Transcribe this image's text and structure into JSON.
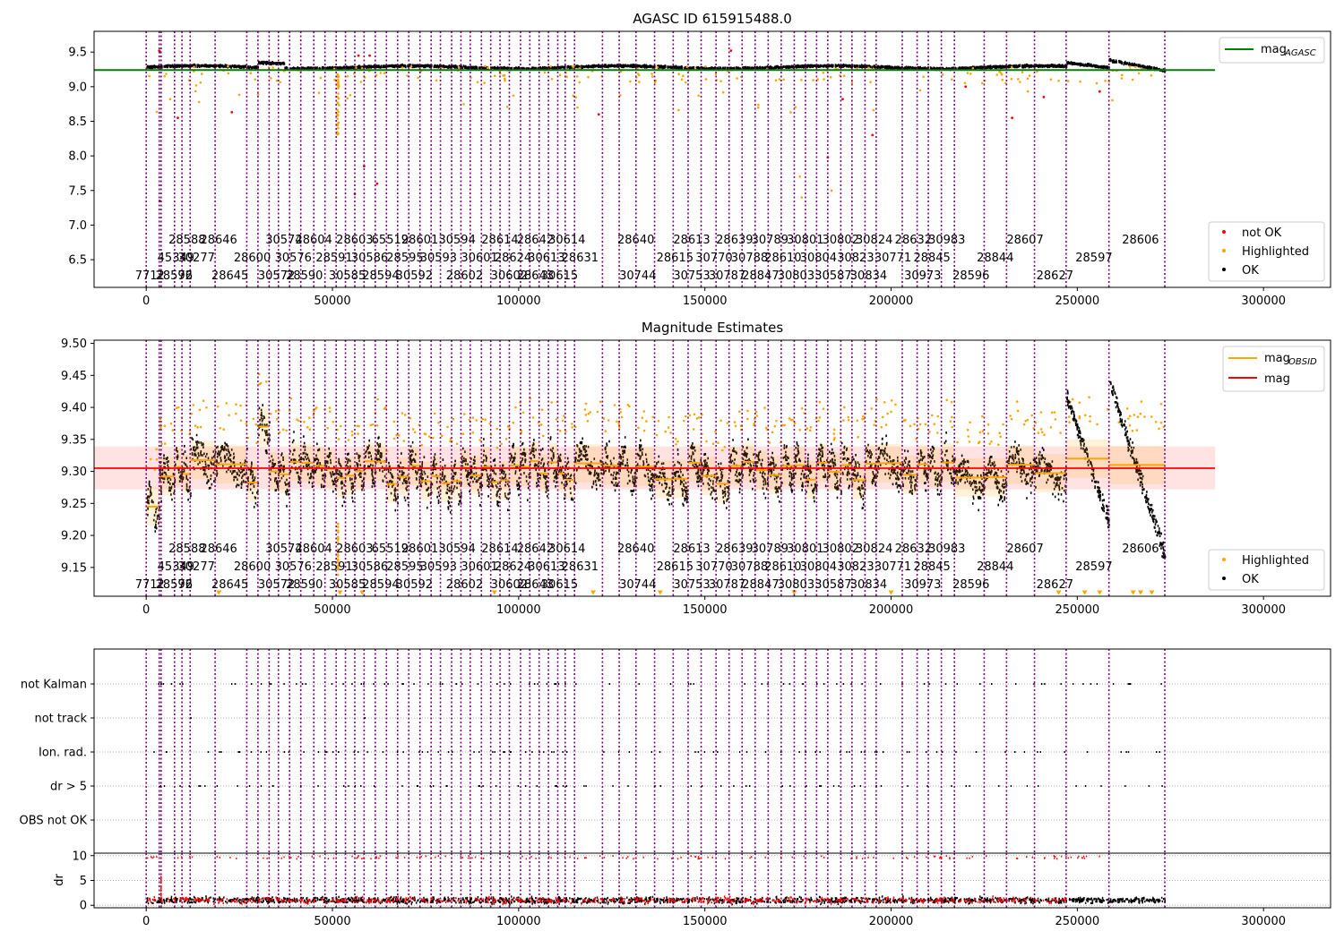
{
  "figure": {
    "background": "#ffffff"
  },
  "colors": {
    "ok": "#000000",
    "highlighted": "#ffa500",
    "not_ok": "#ff0000",
    "agasc_line": "#008000",
    "mag_line": "#ff0000",
    "mag_obsid_line": "#ffa500",
    "obs_boundary": "#800080",
    "mag_band": "#ffcccc"
  },
  "chart_data": [
    {
      "id": "panel-1",
      "type": "scatter",
      "title": "AGASC ID 615915488.0",
      "xlabel": "",
      "ylabel": "",
      "xlim": [
        -14000,
        318000
      ],
      "ylim": [
        6.1,
        9.8
      ],
      "x_ticks": [
        0,
        50000,
        100000,
        150000,
        200000,
        250000,
        300000
      ],
      "x_tick_labels": [
        "0",
        "50000",
        "100000",
        "150000",
        "200000",
        "250000",
        "300000"
      ],
      "y_ticks": [
        6.5,
        7.0,
        7.5,
        8.0,
        8.5,
        9.0,
        9.5
      ],
      "y_tick_labels": [
        "6.5",
        "7.0",
        "7.5",
        "8.0",
        "8.5",
        "9.0",
        "9.5"
      ],
      "grid": false,
      "agasc_mag": 9.24,
      "agasc_line_x": [
        -14000,
        287000
      ],
      "series": [
        {
          "name": "not OK",
          "color": "#ff0000"
        },
        {
          "name": "Highlighted",
          "color": "#ffa500"
        },
        {
          "name": "OK",
          "color": "#000000"
        }
      ],
      "legend_upper": {
        "position": "top-right",
        "entries": [
          {
            "label": "mag",
            "sub": "AGASC",
            "color": "#008000"
          }
        ]
      },
      "legend_lower": {
        "position": "bottom-right",
        "entries": [
          {
            "label": "not OK",
            "color": "#ff0000"
          },
          {
            "label": "Highlighted",
            "color": "#ffa500"
          },
          {
            "label": "OK",
            "color": "#000000"
          }
        ]
      }
    },
    {
      "id": "panel-2",
      "type": "scatter",
      "title": "Magnitude Estimates",
      "xlabel": "",
      "ylabel": "",
      "xlim": [
        -14000,
        318000
      ],
      "ylim": [
        9.105,
        9.505
      ],
      "x_ticks": [
        0,
        50000,
        100000,
        150000,
        200000,
        250000,
        300000
      ],
      "x_tick_labels": [
        "0",
        "50000",
        "100000",
        "150000",
        "200000",
        "250000",
        "300000"
      ],
      "y_ticks": [
        9.15,
        9.2,
        9.25,
        9.3,
        9.35,
        9.4,
        9.45,
        9.5
      ],
      "y_tick_labels": [
        "9.15",
        "9.20",
        "9.25",
        "9.30",
        "9.35",
        "9.40",
        "9.45",
        "9.50"
      ],
      "grid": false,
      "mag": 9.305,
      "mag_band": [
        9.272,
        9.339
      ],
      "mag_line_x": [
        -14000,
        287000
      ],
      "legend_upper": {
        "position": "top-right",
        "entries": [
          {
            "label": "mag",
            "sub": "OBSID",
            "color": "#ffa500"
          },
          {
            "label": "mag",
            "sub": "",
            "color": "#ff0000"
          }
        ]
      },
      "legend_lower": {
        "position": "bottom-right",
        "entries": [
          {
            "label": "Highlighted",
            "color": "#ffa500"
          },
          {
            "label": "OK",
            "color": "#000000"
          }
        ]
      }
    },
    {
      "id": "panel-3",
      "type": "scatter",
      "title": "",
      "xlim": [
        -14000,
        318000
      ],
      "categories": [
        "not Kalman",
        "not track",
        "Ion. rad.",
        "dr > 5",
        "OBS not OK"
      ],
      "grid": true
    },
    {
      "id": "panel-4",
      "type": "scatter",
      "title": "",
      "xlabel": "",
      "ylabel": "dr",
      "xlim": [
        -14000,
        318000
      ],
      "ylim": [
        -0.5,
        10.5
      ],
      "x_ticks": [
        0,
        50000,
        100000,
        150000,
        200000,
        250000,
        300000
      ],
      "x_tick_labels": [
        "0",
        "50000",
        "100000",
        "150000",
        "200000",
        "250000",
        "300000"
      ],
      "y_ticks": [
        0,
        5,
        10
      ],
      "y_tick_labels": [
        "0",
        "5",
        "10"
      ],
      "grid": true
    }
  ],
  "observation_boundaries": [
    0,
    3500,
    4000,
    7600,
    9600,
    11800,
    18500,
    27000,
    30000,
    33000,
    35500,
    38500,
    41500,
    45000,
    48000,
    51000,
    53500,
    56000,
    58500,
    61500,
    64500,
    67500,
    70500,
    73500,
    76500,
    79000,
    82000,
    84500,
    87000,
    90000,
    92500,
    95000,
    97500,
    100500,
    103000,
    105500,
    108000,
    110500,
    112500,
    115000,
    122500,
    127000,
    131500,
    136500,
    141500,
    145500,
    149000,
    153000,
    156500,
    160000,
    163500,
    167000,
    170500,
    174000,
    177000,
    180000,
    183000,
    186500,
    189500,
    193000,
    196000,
    203000,
    207000,
    210000,
    213500,
    217000,
    225000,
    231000,
    238500,
    247000,
    258500,
    273500
  ],
  "obsid_labels": [
    {
      "row": 0,
      "x": 6000,
      "text": "28588"
    },
    {
      "row": 0,
      "x": 14500,
      "text": "28646"
    },
    {
      "row": 0,
      "x": 32000,
      "text": "30574"
    },
    {
      "row": 0,
      "x": 40000,
      "text": "28604"
    },
    {
      "row": 0,
      "x": 51000,
      "text": "28603"
    },
    {
      "row": 0,
      "x": 60500,
      "text": "65519"
    },
    {
      "row": 0,
      "x": 68500,
      "text": "28601"
    },
    {
      "row": 0,
      "x": 78500,
      "text": "30594"
    },
    {
      "row": 0,
      "x": 90000,
      "text": "28614"
    },
    {
      "row": 0,
      "x": 99500,
      "text": "28642"
    },
    {
      "row": 0,
      "x": 108000,
      "text": "30614"
    },
    {
      "row": 0,
      "x": 126500,
      "text": "28640"
    },
    {
      "row": 0,
      "x": 141500,
      "text": "28613"
    },
    {
      "row": 0,
      "x": 153000,
      "text": "28639"
    },
    {
      "row": 0,
      "x": 162500,
      "text": "30789"
    },
    {
      "row": 0,
      "x": 172000,
      "text": "30801"
    },
    {
      "row": 0,
      "x": 181500,
      "text": "30802"
    },
    {
      "row": 0,
      "x": 190500,
      "text": "30824"
    },
    {
      "row": 0,
      "x": 201000,
      "text": "28632"
    },
    {
      "row": 0,
      "x": 210000,
      "text": "30983"
    },
    {
      "row": 0,
      "x": 231000,
      "text": "28607"
    },
    {
      "row": 0,
      "x": 262000,
      "text": "28606"
    },
    {
      "row": 1,
      "x": 3000,
      "text": "45349"
    },
    {
      "row": 1,
      "x": 8500,
      "text": "30277"
    },
    {
      "row": 1,
      "x": 23500,
      "text": "28600"
    },
    {
      "row": 1,
      "x": 34500,
      "text": "30576"
    },
    {
      "row": 1,
      "x": 45500,
      "text": "28591"
    },
    {
      "row": 1,
      "x": 55000,
      "text": "30586"
    },
    {
      "row": 1,
      "x": 64500,
      "text": "28595"
    },
    {
      "row": 1,
      "x": 73500,
      "text": "30593"
    },
    {
      "row": 1,
      "x": 84500,
      "text": "30601"
    },
    {
      "row": 1,
      "x": 93500,
      "text": "28624"
    },
    {
      "row": 1,
      "x": 102500,
      "text": "30613"
    },
    {
      "row": 1,
      "x": 111500,
      "text": "28631"
    },
    {
      "row": 1,
      "x": 137000,
      "text": "28615"
    },
    {
      "row": 1,
      "x": 147500,
      "text": "30770"
    },
    {
      "row": 1,
      "x": 157000,
      "text": "30788"
    },
    {
      "row": 1,
      "x": 166000,
      "text": "28610"
    },
    {
      "row": 1,
      "x": 175500,
      "text": "30804"
    },
    {
      "row": 1,
      "x": 185500,
      "text": "30823"
    },
    {
      "row": 1,
      "x": 195500,
      "text": "30771"
    },
    {
      "row": 1,
      "x": 206000,
      "text": "28845"
    },
    {
      "row": 1,
      "x": 223000,
      "text": "28844"
    },
    {
      "row": 1,
      "x": 249500,
      "text": "28597"
    },
    {
      "row": 2,
      "x": -3000,
      "text": "7712"
    },
    {
      "row": 2,
      "x": 2500,
      "text": "28592"
    },
    {
      "row": 2,
      "x": 8500,
      "text": "76"
    },
    {
      "row": 2,
      "x": 17500,
      "text": "28645"
    },
    {
      "row": 2,
      "x": 30000,
      "text": "30572"
    },
    {
      "row": 2,
      "x": 37500,
      "text": "28590"
    },
    {
      "row": 2,
      "x": 49000,
      "text": "30585"
    },
    {
      "row": 2,
      "x": 58000,
      "text": "28594"
    },
    {
      "row": 2,
      "x": 67000,
      "text": "30592"
    },
    {
      "row": 2,
      "x": 80500,
      "text": "28602"
    },
    {
      "row": 2,
      "x": 92500,
      "text": "30602"
    },
    {
      "row": 2,
      "x": 99500,
      "text": "28643"
    },
    {
      "row": 2,
      "x": 106000,
      "text": "30615"
    },
    {
      "row": 2,
      "x": 127000,
      "text": "30744"
    },
    {
      "row": 2,
      "x": 141500,
      "text": "30753"
    },
    {
      "row": 2,
      "x": 151000,
      "text": "30787"
    },
    {
      "row": 2,
      "x": 160000,
      "text": "28847"
    },
    {
      "row": 2,
      "x": 169500,
      "text": "30803"
    },
    {
      "row": 2,
      "x": 179500,
      "text": "30587"
    },
    {
      "row": 2,
      "x": 189000,
      "text": "30834"
    },
    {
      "row": 2,
      "x": 203500,
      "text": "30973"
    },
    {
      "row": 2,
      "x": 216500,
      "text": "28596"
    },
    {
      "row": 2,
      "x": 239000,
      "text": "28627"
    }
  ]
}
